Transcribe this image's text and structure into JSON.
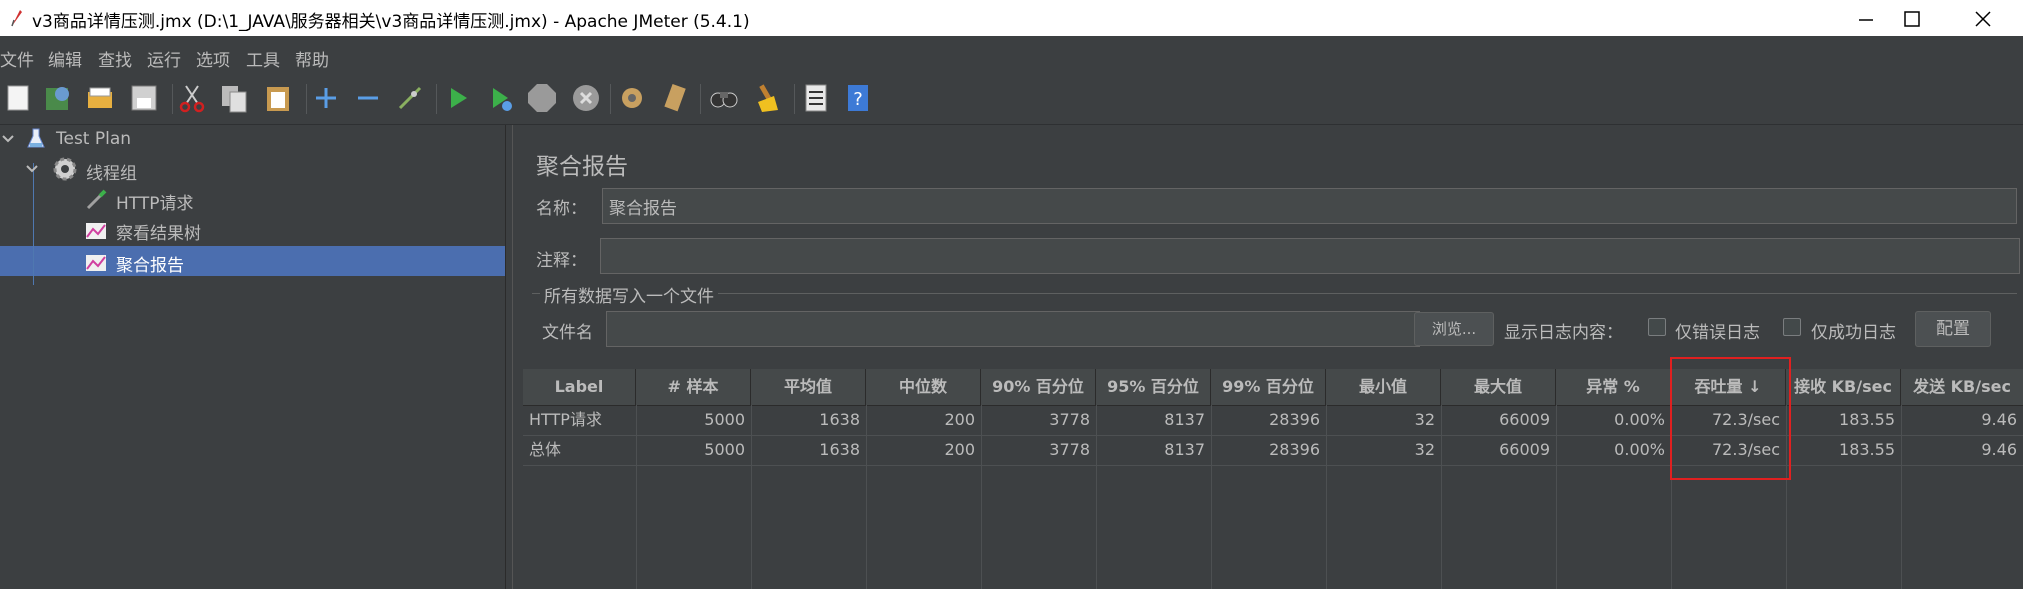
{
  "window": {
    "title": "v3商品详情压测.jmx (D:\\1_JAVA\\服务器相关\\v3商品详情压测.jmx) - Apache JMeter (5.4.1)"
  },
  "menu": [
    "文件",
    "编辑",
    "查找",
    "运行",
    "选项",
    "工具",
    "帮助"
  ],
  "toolbar_icons": [
    "new-icon",
    "templates-icon",
    "open-icon",
    "save-icon",
    "cut-icon",
    "copy-icon",
    "paste-icon",
    "expand-icon",
    "collapse-icon",
    "toggle-icon",
    "start-icon",
    "start-no-pause-icon",
    "stop-icon",
    "shutdown-icon",
    "clear-icon",
    "clear-all-icon",
    "search-icon",
    "reset-search-icon",
    "function-helper-icon",
    "help-icon"
  ],
  "tree": {
    "items": [
      {
        "label": "Test Plan"
      },
      {
        "label": "线程组"
      },
      {
        "label": "HTTP请求"
      },
      {
        "label": "察看结果树"
      },
      {
        "label": "聚合报告"
      }
    ]
  },
  "panel": {
    "title": "聚合报告",
    "name_label": "名称：",
    "name_value": "聚合报告",
    "comment_label": "注释：",
    "comment_value": "",
    "group_title": "所有数据写入一个文件",
    "filename_label": "文件名",
    "filename_value": "",
    "browse_button": "浏览...",
    "log_label": "显示日志内容：",
    "errors_only_label": "仅错误日志",
    "success_only_label": "仅成功日志",
    "configure_button": "配置"
  },
  "table": {
    "headers": [
      "Label",
      "# 样本",
      "平均值",
      "中位数",
      "90% 百分位",
      "95% 百分位",
      "99% 百分位",
      "最小值",
      "最大值",
      "异常 %",
      "吞吐量 ↓",
      "接收 KB/sec",
      "发送 KB/sec"
    ],
    "rows": [
      [
        "HTTP请求",
        "5000",
        "1638",
        "200",
        "3778",
        "8137",
        "28396",
        "32",
        "66009",
        "0.00%",
        "72.3/sec",
        "183.55",
        "9.46"
      ],
      [
        "总体",
        "5000",
        "1638",
        "200",
        "3778",
        "8137",
        "28396",
        "32",
        "66009",
        "0.00%",
        "72.3/sec",
        "183.55",
        "9.46"
      ]
    ]
  },
  "colors": {
    "background": "#3c3f41",
    "selection": "#4b6eaf",
    "highlight_box": "#e02020"
  }
}
